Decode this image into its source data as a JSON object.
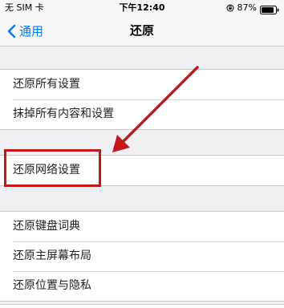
{
  "status_bar": {
    "carrier": "无 SIM 卡",
    "time": "下午12:40",
    "battery": "87%"
  },
  "nav": {
    "back_label": "通用",
    "title": "还原"
  },
  "groups": [
    {
      "items": [
        "还原所有设置",
        "抹掉所有内容和设置"
      ]
    },
    {
      "items": [
        "还原网络设置"
      ]
    },
    {
      "items": [
        "还原键盘词典",
        "还原主屏幕布局",
        "还原位置与隐私"
      ]
    }
  ],
  "colors": {
    "accent": "#007aff",
    "annotation": "#c21818",
    "background": "#efeff4"
  },
  "icons": {
    "back": "chevron-left-icon",
    "orientation": "lock-rotation-icon",
    "battery": "battery-icon"
  }
}
